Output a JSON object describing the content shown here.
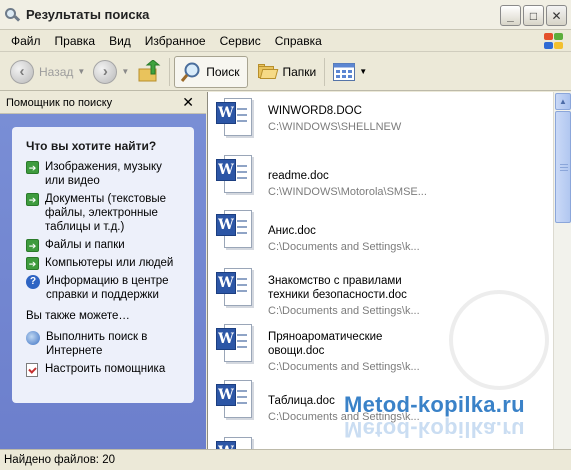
{
  "window": {
    "title": "Результаты поиска",
    "buttons": {
      "minimize": "_",
      "maximize": "□",
      "close": "✕"
    }
  },
  "menubar": {
    "items": [
      "Файл",
      "Правка",
      "Вид",
      "Избранное",
      "Сервис",
      "Справка"
    ]
  },
  "toolbar": {
    "back_label": "Назад",
    "search_label": "Поиск",
    "folders_label": "Папки"
  },
  "left_pane": {
    "title": "Помощник по поиску",
    "close_glyph": "✕",
    "question": "Что вы хотите найти?",
    "options": [
      "Изображения, музыку или видео",
      "Документы (текстовые файлы, электронные таблицы и т.д.)",
      "Файлы и папки",
      "Компьютеры или людей",
      "Информацию в центре справки и поддержки"
    ],
    "also_label": "Вы также можете…",
    "also_options": [
      "Выполнить поиск в Интернете",
      "Настроить помощника"
    ]
  },
  "results": [
    {
      "name": "WINWORD8.DOC",
      "path": "C:\\WINDOWS\\SHELLNEW"
    },
    {
      "name": "readme.doc",
      "path": "C:\\WINDOWS\\Motorola\\SMSE..."
    },
    {
      "name": "Анис.doc",
      "path": "C:\\Documents and Settings\\k..."
    },
    {
      "name": "Знакомство с правилами техники безопасности.doc",
      "path": "C:\\Documents and Settings\\k..."
    },
    {
      "name": "Пряноароматические овощи.doc",
      "path": "C:\\Documents and Settings\\k..."
    },
    {
      "name": "Таблица.doc",
      "path": "C:\\Documents and Settings\\k..."
    }
  ],
  "statusbar": {
    "text": "Найдено файлов: 20"
  },
  "watermark": {
    "text": "Metod-kopilka.ru"
  },
  "colors": {
    "left_pane_bg": "#6C7FCC",
    "card_bg": "#EDF0FA",
    "word_blue": "#2C56A6",
    "watermark": "#3A82C8"
  }
}
